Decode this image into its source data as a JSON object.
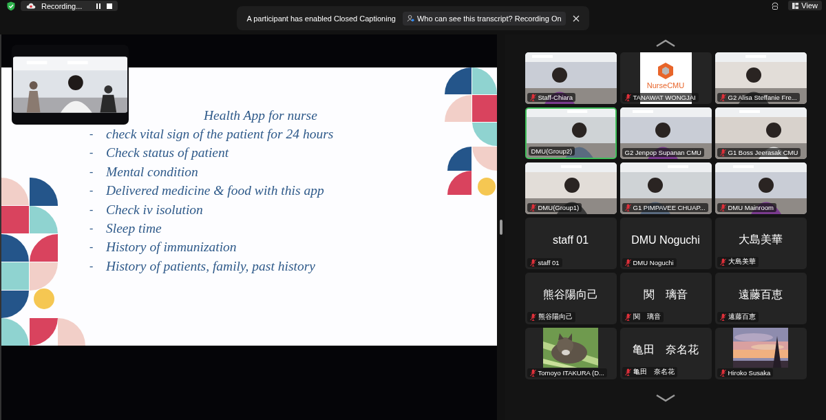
{
  "top_bar": {
    "recording": {
      "label": "Recording..."
    },
    "notification": {
      "message": "A participant has enabled Closed Captioning",
      "button": "Who can see this transcript? Recording On"
    },
    "view_button": "View"
  },
  "share": {
    "slide": {
      "title": "Health App for nurse",
      "bullets": [
        {
          "marker": "-",
          "text": "check vital sign of the patient for 24 hours"
        },
        {
          "marker": "-",
          "text": "Check status of patient"
        },
        {
          "marker": "-",
          "text": "Mental condition"
        },
        {
          "marker": "-",
          "text": "Delivered medicine & food with this app"
        },
        {
          "marker": "-",
          "text": "Check iv isolution"
        },
        {
          "marker": "-",
          "text": "Sleep time"
        },
        {
          "marker": "-",
          "text": "History of immunization"
        },
        {
          "marker": "-",
          "text": "History of patients, family, past history"
        }
      ]
    }
  },
  "gallery": {
    "tiles": [
      {
        "kind": "video",
        "name": "Staff-Chiara",
        "muted": true,
        "active": false
      },
      {
        "kind": "logo",
        "name": "TANAWAT WONGJAI",
        "muted": true,
        "active": false,
        "logo_text": "NurseCMU"
      },
      {
        "kind": "video",
        "name": "G2 Alisa Steffanie Fre...",
        "muted": true,
        "active": false
      },
      {
        "kind": "video",
        "name": "DMU(Group2)",
        "muted": false,
        "active": true
      },
      {
        "kind": "video",
        "name": "G2 Jenpop Supanan CMU",
        "muted": false,
        "active": false
      },
      {
        "kind": "video",
        "name": "G1 Boss Jeerasak CMU",
        "muted": true,
        "active": false
      },
      {
        "kind": "video",
        "name": "DMU(Group1)",
        "muted": true,
        "active": false
      },
      {
        "kind": "video",
        "name": "G1 PIMPAVEE CHUAP...",
        "muted": true,
        "active": false
      },
      {
        "kind": "video",
        "name": "DMU Mainroom",
        "muted": true,
        "active": false
      },
      {
        "kind": "name",
        "display_name": "staff 01",
        "name": "staff 01",
        "muted": true,
        "active": false
      },
      {
        "kind": "name",
        "display_name": "DMU Noguchi",
        "name": "DMU Noguchi",
        "muted": true,
        "active": false
      },
      {
        "kind": "name",
        "display_name": "大島美華",
        "name": "大島美華",
        "muted": true,
        "active": false
      },
      {
        "kind": "name",
        "display_name": "熊谷陽向己",
        "name": "熊谷陽向己",
        "muted": true,
        "active": false
      },
      {
        "kind": "name",
        "display_name": "関　璃音",
        "name": "関　璃音",
        "muted": true,
        "active": false
      },
      {
        "kind": "name",
        "display_name": "遠藤百恵",
        "name": "遠藤百恵",
        "muted": true,
        "active": false
      },
      {
        "name": "Tomoyo ITAKURA (D...",
        "muted": true,
        "active": false
      },
      {
        "kind": "name",
        "display_name": "亀田　奈名花",
        "name": "亀田　奈名花",
        "muted": true,
        "active": false
      },
      {
        "name": "Hiroko Susaka",
        "muted": true,
        "active": false
      }
    ]
  }
}
